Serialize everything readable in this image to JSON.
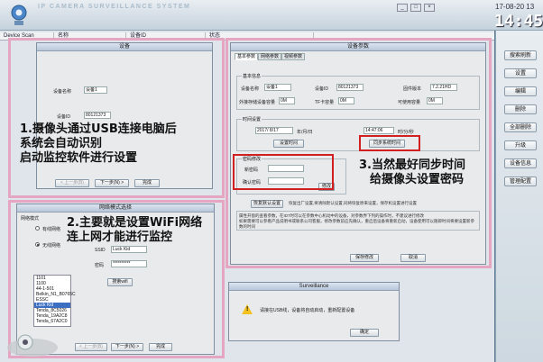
{
  "app": {
    "title": "IP CAMERA SURVEILLANCE SYSTEM",
    "date": "17-08-20 13",
    "time": "14:45",
    "window_controls": [
      "_",
      "□",
      "×"
    ]
  },
  "device_list": {
    "tree_label": "Device Scan",
    "columns": [
      "名称",
      "设备ID",
      "状态"
    ]
  },
  "sidebar": {
    "buttons": [
      "搜索刷新",
      "设置",
      "编辑",
      "删除",
      "全部删除",
      "升级",
      "设备信息",
      "管理配置"
    ]
  },
  "dialog_device": {
    "title": "设备",
    "labels": {
      "device_name": "设备名称",
      "device_id": "设备ID"
    },
    "values": {
      "device_name": "设备1",
      "device_id": "80121373"
    },
    "buttons": {
      "prev": "< 上一步(B)",
      "next": "下一步(N) >",
      "finish": "完成"
    }
  },
  "dialog_wifi": {
    "title": "网络模式选择",
    "network_mode_label": "网络模式",
    "wired_label": "有线网络",
    "wireless_label": "无线网络",
    "ssid_label": "SSID",
    "ssid_value": "Luck Kid",
    "password_label": "密码",
    "password_value": "**********",
    "search_button": "搜索wifi",
    "networks": [
      "1101",
      "1100",
      "44-1-501",
      "Belkin_N1_B0765C",
      "ESSC",
      "Luck Kid",
      "Tenda_8C5026",
      "Tenda_19A2C8",
      "Tenda_67A2C0"
    ],
    "selected_network": "Luck Kid",
    "buttons": {
      "prev": "< 上一步(B)",
      "next": "下一步(N) >",
      "finish": "完成"
    }
  },
  "dialog_params": {
    "title": "设备参数",
    "tabs": [
      "基本参数",
      "网络参数",
      "视频参数"
    ],
    "basic_info": {
      "group_title": "基本信息",
      "name_label": "设备名称",
      "name_value": "设备1",
      "id_label": "设备ID",
      "id_value": "80121373",
      "fw_label": "固件版本",
      "fw_value": "7.2.21HD",
      "ext_label": "外接存储设备容量",
      "ext_value": "0M",
      "tf_label": "TF卡容量",
      "tf_value": "0M",
      "free_label": "可使用容量",
      "free_value": "0M"
    },
    "time_settings": {
      "group_title": "时间设置",
      "date_value": "2017/ 8/17",
      "ymd_label": "年/月/日",
      "time_value": "14:47:06",
      "hms_label": "时/分/秒",
      "set_time_button": "设置时间",
      "sync_button": "同步系统时间"
    },
    "password_change": {
      "group_title": "密码修改",
      "new_label": "新密码",
      "confirm_label": "确认密码",
      "modify_button": "修改"
    },
    "restore_button": "恢复默认设置",
    "restore_note": "恢复出厂设置,将清除默认设置,同将恢复原来设置，保存机设置进行设置",
    "notes": "属性开窗的查看参数，在ID7时可以在参数中心机动中的设备，对参数界下列的操作时，不建议进行修改\n如果需要可以参看产品说明书或联系公司客服，修改参数前应先确认，重启后设备将重新启动，设备使用可以随即时间将要设置新参数的时间",
    "save_button": "保存修改",
    "cancel_button": "取消"
  },
  "dialog_msg": {
    "title": "Surveillance",
    "message": "请接在USB线，设备将自动启动，重新配置设备",
    "ok_button": "确定"
  },
  "annotations": {
    "a1": [
      "1.摄像头通过USB连接电脑后",
      "系统会自动识别",
      "启动监控软件进行设置"
    ],
    "a2": [
      "2.主要就是设置WiFi网络",
      "连上网才能进行监控"
    ],
    "a3": [
      "3.当然最好同步时间",
      "给摄像头设置密码"
    ]
  },
  "colors": {
    "frame_pink": "#e4a6c0",
    "highlight_red": "#d21f1f",
    "selection_blue": "#3c6fc2",
    "clock_white": "#ffffff"
  }
}
